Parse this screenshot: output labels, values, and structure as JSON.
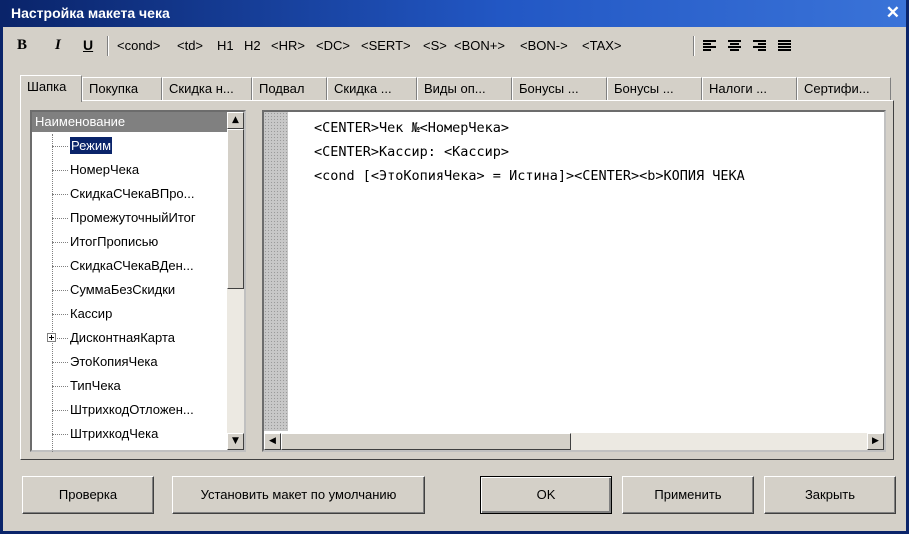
{
  "window": {
    "title": "Настройка макета чека",
    "close_symbol": "✕"
  },
  "toolbar": {
    "bold": "B",
    "italic": "I",
    "underline": "U",
    "tags": [
      "<cond>",
      "<td>",
      "H1",
      "H2",
      "<HR>",
      "<DC>",
      "<SERT>",
      "<S>",
      "<BON+>",
      "<BON->",
      "<TAX>"
    ],
    "align_icons": [
      "align-left-icon",
      "align-center-icon",
      "align-right-icon",
      "align-justify-icon"
    ]
  },
  "tabs": [
    "Шапка",
    "Покупка",
    "Скидка н...",
    "Подвал",
    "Скидка ...",
    "Виды оп...",
    "Бонусы ...",
    "Бонусы ...",
    "Налоги ...",
    "Сертифи..."
  ],
  "active_tab": "Шапка",
  "tree": {
    "header": "Наименование",
    "selected": "Режим",
    "items": [
      "Режим",
      "НомерЧека",
      "СкидкаСЧекаВПро...",
      "ПромежуточныйИтог",
      "ИтогПрописью",
      "СкидкаСЧекаВДен...",
      "СуммаБезСкидки",
      "Кассир",
      "ДисконтнаяКарта",
      "ЭтоКопияЧека",
      "ТипЧека",
      "ШтрихкодОтложен...",
      "ШтрихкодЧека"
    ],
    "expandable_item": "ДисконтнаяКарта"
  },
  "editor": {
    "lines": [
      "<CENTER>Чек №<НомерЧека>",
      "<CENTER>Кассир: <Кассир>",
      "<cond [<ЭтоКопияЧека> = Истина]><CENTER><b>КОПИЯ ЧЕКА"
    ]
  },
  "buttons": {
    "check": "Проверка",
    "set_default": "Установить макет по умолчанию",
    "ok": "OK",
    "apply": "Применить",
    "close": "Закрыть"
  },
  "colors": {
    "title_bar": "#0a246a",
    "face": "#d4d0c8",
    "selection": "#0a246a"
  }
}
